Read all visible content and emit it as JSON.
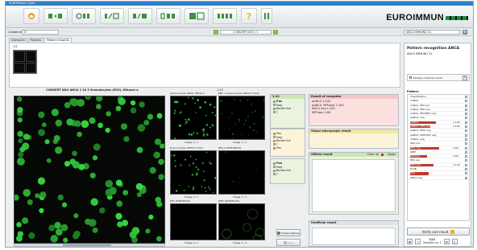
{
  "window": {
    "title": "EUROPattern Suite"
  },
  "toolbar": {
    "buttons": [
      {
        "name": "home-icon",
        "color": "#e8a21a"
      },
      {
        "name": "toolbar-grid-1-icon",
        "color": "#3f8f3f"
      },
      {
        "name": "toolbar-grid-2-icon",
        "color": "#3f8f3f"
      },
      {
        "name": "toolbar-grid-3-icon",
        "color": "#3f8f3f"
      },
      {
        "name": "toolbar-grid-4-icon",
        "color": "#3f8f3f"
      },
      {
        "name": "toolbar-grid-5-icon",
        "color": "#3f8f3f"
      },
      {
        "name": "toolbar-grid-6-icon",
        "color": "#3f8f3f"
      },
      {
        "name": "toolbar-grid-7-icon",
        "color": "#3f8f3f"
      },
      {
        "name": "help-icon",
        "color": "#e8c21a"
      },
      {
        "name": "pause-icon",
        "color": "#3f8f3f"
      }
    ],
    "help_label": "?",
    "brand": "EUROIMMUN",
    "brand_color": "#1d8a3a"
  },
  "subbar": {
    "container_label": "Container",
    "container_value": "17",
    "sample_id": "CONVERT NOV / 1",
    "substrate": "ANCA IMMUNO 21"
  },
  "tabs": [
    {
      "label": "Übersicht"
    },
    {
      "label": "Patches"
    },
    {
      "label": "Pattern Graphik"
    }
  ],
  "thumb": {
    "label": "1/1"
  },
  "main_image": {
    "caption": "CONVERT NOV ANCA 1 10 3 Granulocytes (EOS), Ethanol  a"
  },
  "sub_images": {
    "caption_top": "1:10",
    "tiles": [
      {
        "title": "Granulocytes (EOS), Ethanol",
        "footer": "Image 1 / 1"
      },
      {
        "title": "RBC 1 Granulocytes (EOS) Formal",
        "footer": "Image 1 / 1"
      },
      {
        "title": "Granulocytes (EOS) Formal",
        "footer": "Image 1 / 1"
      },
      {
        "title": "HEp-2 (EUROPLUS)",
        "footer": "Image 1 / 1"
      },
      {
        "title": "PR3 (EUROPLUS)",
        "footer": "Image 1 / 1"
      },
      {
        "title": "MPO (EUROPLUS)",
        "footer": "Image 1 / 1"
      }
    ]
  },
  "classification": {
    "title": "1:10",
    "options": [
      "Pos",
      "Neg",
      "Borderline",
      "?"
    ]
  },
  "classification2": {
    "options": [
      "Pos",
      "Neg",
      "Borderline",
      "?",
      "Pos"
    ]
  },
  "classification3": {
    "options": [
      "Pos",
      "Neg",
      "Borderline",
      "?"
    ]
  },
  "result_computer": {
    "title": "Result of computer",
    "lines": [
      "pANCA 1:100",
      "pANCA, MPOpos 1:100",
      "ANCA neg 1:100",
      "MPOpos 1:80"
    ]
  },
  "visual_result": {
    "title": "Visual microscopic result"
  },
  "official_result": {
    "title": "Official result",
    "clear_label": "Clear all",
    "apply_label": "Apply"
  },
  "unofficial_result": {
    "title": "Unofficial result"
  },
  "actions": {
    "follow_up": "Follow Capture",
    "save": "Save"
  },
  "pattern_panel": {
    "title": "Pattern recognition ANCA",
    "subtitle": "ANCA IMMUNO 21",
    "display_label": "Display computer result",
    "patterns_label": "Pattern",
    "verify_label": "Verify and result",
    "counter_top": "1/11",
    "counter_bottom": "Samples no. 1",
    "rows": [
      {
        "label": "Classification",
        "bar": 0,
        "value": ""
      },
      {
        "label": "cANCA",
        "bar": 0,
        "value": ""
      },
      {
        "label": "cANCA, PR3 pos",
        "bar": 0,
        "value": ""
      },
      {
        "label": "cANCA, MPO pos",
        "bar": 0,
        "value": ""
      },
      {
        "label": "cANCA, PR3/MPO neg",
        "bar": 0,
        "value": ""
      },
      {
        "label": "pANCA, neg",
        "bar": 0,
        "value": ""
      },
      {
        "label": "pANCA",
        "bar": 0.62,
        "value": "1:100"
      },
      {
        "label": "pANCA, MPO pos",
        "bar": 0.48,
        "value": "1:100"
      },
      {
        "label": "pANCA, MPO neg",
        "bar": 0,
        "value": ""
      },
      {
        "label": "pANCA, MPO/PR3 neg",
        "bar": 0,
        "value": ""
      },
      {
        "label": "xANCA, neg",
        "bar": 0,
        "value": ""
      },
      {
        "label": "ANA pos",
        "bar": 0,
        "value": ""
      },
      {
        "label": "ANA neg",
        "bar": 0.7,
        "value": "1:80"
      },
      {
        "label": "GBM",
        "bar": 0,
        "value": ""
      },
      {
        "label": "MPOpos",
        "bar": 0.4,
        "value": "1:80"
      },
      {
        "label": "PR3 pos",
        "bar": 0,
        "value": ""
      },
      {
        "label": "MPO pos",
        "bar": 0.55,
        "value": "1:100"
      },
      {
        "label": "EndB",
        "bar": 0,
        "value": ""
      },
      {
        "label": "Neg",
        "bar": 0.45,
        "value": ""
      },
      {
        "label": "ANCA neg",
        "bar": 0,
        "value": ""
      }
    ]
  }
}
